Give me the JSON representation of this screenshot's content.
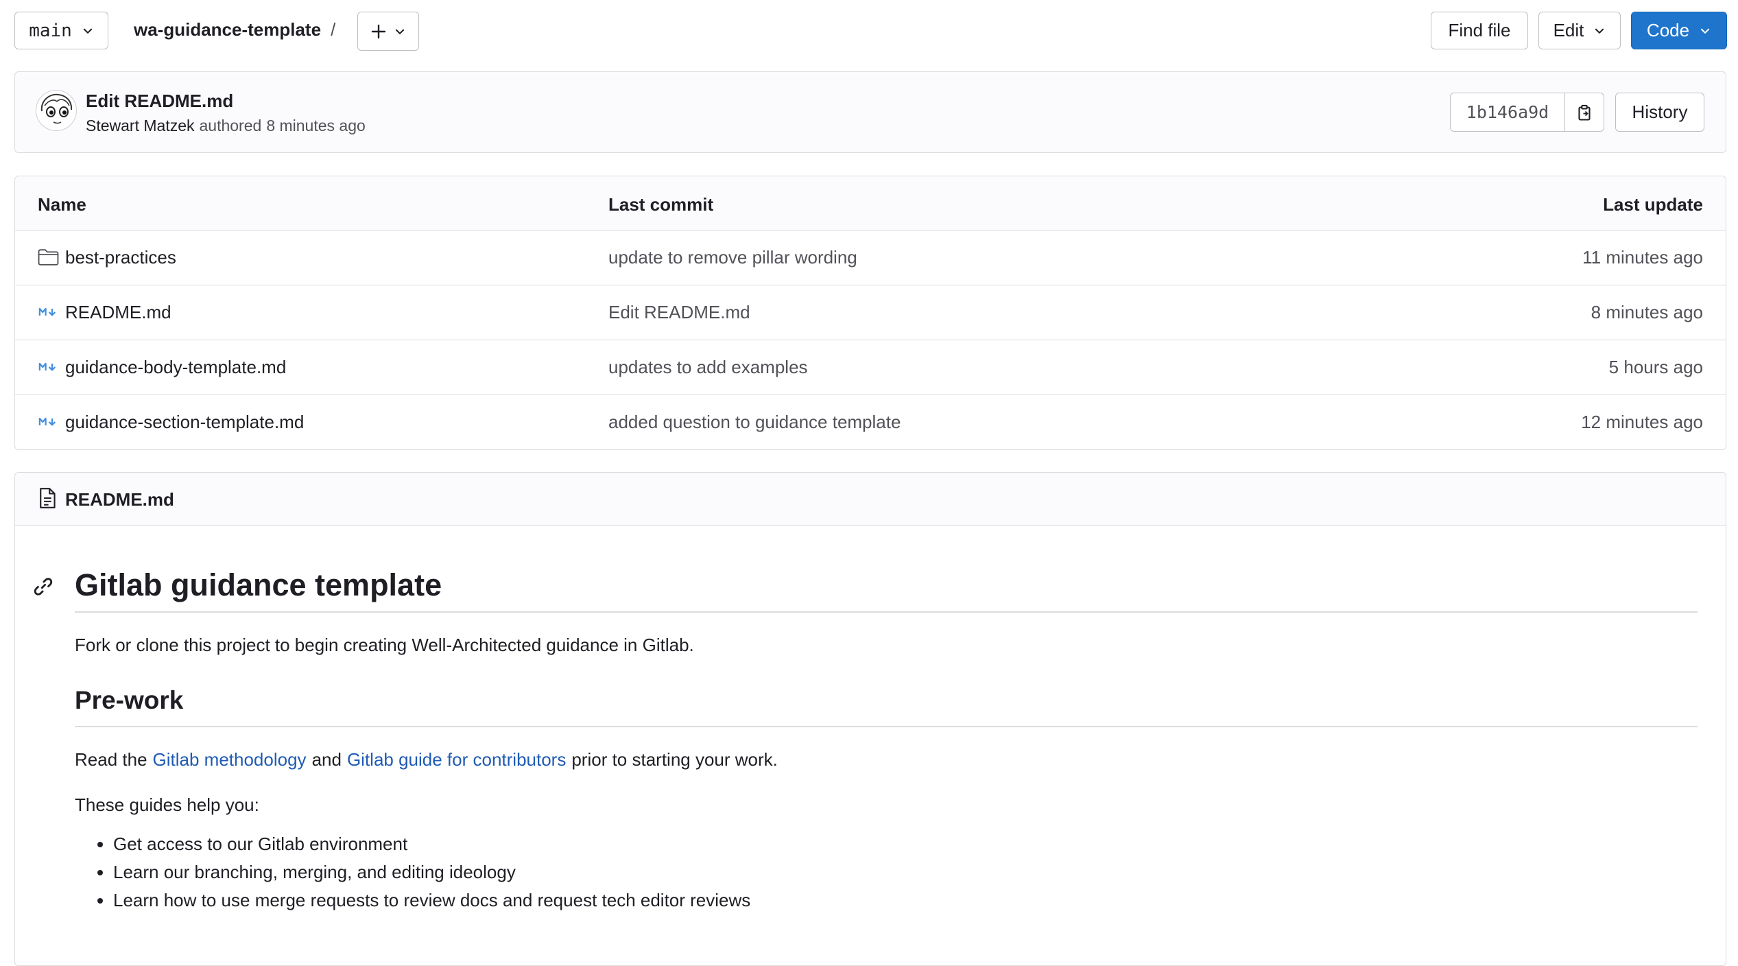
{
  "header": {
    "branch": "main",
    "project": "wa-guidance-template",
    "separator": "/",
    "find_file": "Find file",
    "edit": "Edit",
    "code": "Code"
  },
  "commit": {
    "title": "Edit README.md",
    "author": "Stewart Matzek",
    "authored_text": "authored",
    "time": "8 minutes ago",
    "sha": "1b146a9d",
    "history": "History"
  },
  "files": {
    "headers": {
      "name": "Name",
      "last_commit": "Last commit",
      "last_update": "Last update"
    },
    "rows": [
      {
        "name": "best-practices",
        "type": "folder",
        "commit": "update to remove pillar wording",
        "updated": "11 minutes ago"
      },
      {
        "name": "README.md",
        "type": "markdown",
        "commit": "Edit README.md",
        "updated": "8 minutes ago"
      },
      {
        "name": "guidance-body-template.md",
        "type": "markdown",
        "commit": "updates to add examples",
        "updated": "5 hours ago"
      },
      {
        "name": "guidance-section-template.md",
        "type": "markdown",
        "commit": "added question to guidance template",
        "updated": "12 minutes ago"
      }
    ]
  },
  "readme": {
    "filename": "README.md",
    "h1": "Gitlab guidance template",
    "intro": "Fork or clone this project to begin creating Well-Architected guidance in Gitlab.",
    "h2": "Pre-work",
    "read_prefix": "Read the",
    "link1": "Gitlab methodology",
    "read_and": "and",
    "link2": "Gitlab guide for contributors",
    "read_suffix": "prior to starting your work.",
    "guides_intro": "These guides help you:",
    "bullets": [
      "Get access to our Gitlab environment",
      "Learn our branching, merging, and editing ideology",
      "Learn how to use merge requests to review docs and request tech editor reviews"
    ]
  },
  "colors": {
    "primary": "#1f75cb",
    "link": "#1f5bb4",
    "border": "#dcdcde",
    "muted_text": "#535158"
  },
  "icons": [
    "chevron-down-icon",
    "plus-icon",
    "copy-icon",
    "folder-icon",
    "markdown-icon",
    "file-icon",
    "link-icon",
    "avatar"
  ]
}
